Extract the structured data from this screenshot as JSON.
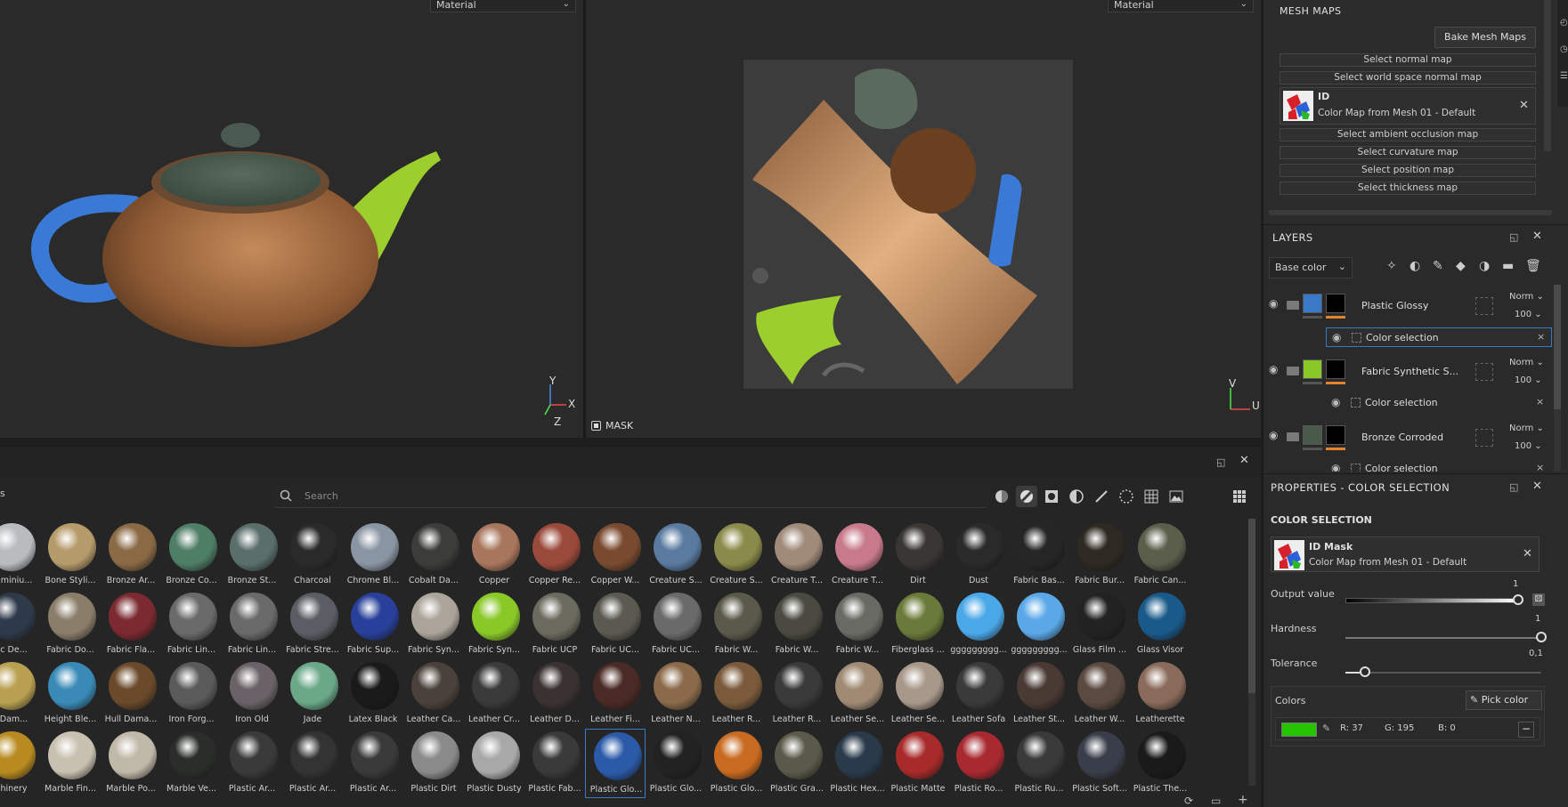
{
  "viewport3d": {
    "mode_label": "Material",
    "axes": [
      "Y",
      "X",
      "Z"
    ]
  },
  "viewport2d": {
    "mode_label": "Material",
    "mask_label": "MASK",
    "axes": [
      "V",
      "U"
    ]
  },
  "colors": {
    "accent_blue": "#3a78c8",
    "orange": "#e4822d",
    "id_green": "#25c300",
    "panel": "#2a2a2a",
    "background": "#1e1e1e"
  },
  "shelf": {
    "partial_title": "s",
    "search_placeholder": "Search",
    "filter_icons": [
      "materials-icon",
      "smart-materials-icon",
      "smart-masks-icon",
      "filters-icon",
      "brushes-icon",
      "particles-icon",
      "textures-icon",
      "environments-icon"
    ],
    "rows": [
      [
        {
          "label": "Aluminiu...",
          "color": "#b8bcbf"
        },
        {
          "label": "Bone Styli...",
          "color": "#b59a6a"
        },
        {
          "label": "Bronze Ar...",
          "color": "#8a6a45"
        },
        {
          "label": "Bronze Co...",
          "color": "#4e7e66"
        },
        {
          "label": "Bronze St...",
          "color": "#5a6e6a"
        },
        {
          "label": "Charcoal",
          "color": "#2a2a2a"
        },
        {
          "label": "Chrome Bl...",
          "color": "#8a95a3"
        },
        {
          "label": "Cobalt Da...",
          "color": "#3c3c3a"
        },
        {
          "label": "Copper",
          "color": "#a8765c"
        },
        {
          "label": "Copper Re...",
          "color": "#9a4a3a"
        },
        {
          "label": "Copper W...",
          "color": "#7a4a30"
        },
        {
          "label": "Creature S...",
          "color": "#5a7aa0"
        },
        {
          "label": "Creature S...",
          "color": "#8a8a4a"
        },
        {
          "label": "Creature T...",
          "color": "#a08a7a"
        },
        {
          "label": "Creature T...",
          "color": "#c87a8a"
        },
        {
          "label": "Dirt",
          "color": "#3a3634"
        },
        {
          "label": "Dust",
          "color": "#2a2a2a"
        },
        {
          "label": "Fabric Bas...",
          "color": "#262626"
        },
        {
          "label": "Fabric Bur...",
          "color": "#2e2a22"
        },
        {
          "label": "Fabric Can...",
          "color": "#5a5e4a"
        }
      ],
      [
        {
          "label": "...c De...",
          "color": "#2e3a4a"
        },
        {
          "label": "Fabric Do...",
          "color": "#8a7e6a"
        },
        {
          "label": "Fabric Fla...",
          "color": "#7a2a30"
        },
        {
          "label": "Fabric Lin...",
          "color": "#6a6a6a"
        },
        {
          "label": "Fabric Lin...",
          "color": "#6a6a6a"
        },
        {
          "label": "Fabric Stre...",
          "color": "#5a5e64"
        },
        {
          "label": "Fabric Sup...",
          "color": "#28409a"
        },
        {
          "label": "Fabric Syn...",
          "color": "#aaa49a"
        },
        {
          "label": "Fabric Syn...",
          "color": "#8ac828"
        },
        {
          "label": "Fabric UCP",
          "color": "#6a6a5e"
        },
        {
          "label": "Fabric UC...",
          "color": "#5a5a50"
        },
        {
          "label": "Fabric UC...",
          "color": "#6a6a6a"
        },
        {
          "label": "Fabric W...",
          "color": "#5a5a4a"
        },
        {
          "label": "Fabric W...",
          "color": "#4a4a40"
        },
        {
          "label": "Fabric W...",
          "color": "#6a6a64"
        },
        {
          "label": "Fiberglass ...",
          "color": "#6a7a3a"
        },
        {
          "label": "ggggggggg...",
          "color": "#4aa8e8"
        },
        {
          "label": "ggggggggg...",
          "color": "#5aa8e8"
        },
        {
          "label": "Glass Film ...",
          "color": "#222222"
        },
        {
          "label": "Glass Visor",
          "color": "#1a5a8a"
        }
      ],
      [
        {
          "label": "...Dam...",
          "color": "#b8a050"
        },
        {
          "label": "Height Ble...",
          "color": "#3a8ab8"
        },
        {
          "label": "Hull Dama...",
          "color": "#6a4a2a"
        },
        {
          "label": "Iron Forg...",
          "color": "#5a5a5a"
        },
        {
          "label": "Iron Old",
          "color": "#6a6266"
        },
        {
          "label": "Jade",
          "color": "#6aa888"
        },
        {
          "label": "Latex Black",
          "color": "#1a1a1a"
        },
        {
          "label": "Leather Ca...",
          "color": "#4a423a"
        },
        {
          "label": "Leather Cr...",
          "color": "#3a3a3a"
        },
        {
          "label": "Leather D...",
          "color": "#3a3230"
        },
        {
          "label": "Leather Fi...",
          "color": "#4a2a24"
        },
        {
          "label": "Leather N...",
          "color": "#8a6a4a"
        },
        {
          "label": "Leather R...",
          "color": "#7a5a3a"
        },
        {
          "label": "Leather R...",
          "color": "#3a3a3a"
        },
        {
          "label": "Leather Se...",
          "color": "#a08a74"
        },
        {
          "label": "Leather Se...",
          "color": "#a8988a"
        },
        {
          "label": "Leather Sofa",
          "color": "#3a3a3a"
        },
        {
          "label": "Leather St...",
          "color": "#4a3a34"
        },
        {
          "label": "Leather W...",
          "color": "#5a4a40"
        },
        {
          "label": "Leatherette",
          "color": "#8a6a5a"
        }
      ],
      [
        {
          "label": "...hinery",
          "color": "#b88a20"
        },
        {
          "label": "Marble Fin...",
          "color": "#c8c0b0"
        },
        {
          "label": "Marble Po...",
          "color": "#c0b8a8"
        },
        {
          "label": "Marble Ve...",
          "color": "#2a2e2a"
        },
        {
          "label": "Plastic Ar...",
          "color": "#3a3a3a"
        },
        {
          "label": "Plastic Ar...",
          "color": "#333333"
        },
        {
          "label": "Plastic Ar...",
          "color": "#3a3a3a"
        },
        {
          "label": "Plastic Dirt",
          "color": "#8a8a8a"
        },
        {
          "label": "Plastic Dusty",
          "color": "#a8a8a8"
        },
        {
          "label": "Plastic Fab...",
          "color": "#3a3a3a"
        },
        {
          "label": "Plastic Glo...",
          "color": "#2a5aa8"
        },
        {
          "label": "Plastic Glo...",
          "color": "#222222"
        },
        {
          "label": "Plastic Glo...",
          "color": "#c86a20"
        },
        {
          "label": "Plastic Gra...",
          "color": "#5a5a4a"
        },
        {
          "label": "Plastic Hex...",
          "color": "#2a3a4a"
        },
        {
          "label": "Plastic Matte",
          "color": "#a82a2a"
        },
        {
          "label": "Plastic Ro...",
          "color": "#a82a30"
        },
        {
          "label": "Plastic Ru...",
          "color": "#3a3a3a"
        },
        {
          "label": "Plastic Soft...",
          "color": "#3a3e4a"
        },
        {
          "label": "Plastic The...",
          "color": "#1a1a1a"
        }
      ]
    ],
    "selected_row": 3,
    "selected_col": 10
  },
  "mesh_maps": {
    "title": "MESH MAPS",
    "bake_label": "Bake Mesh Maps",
    "normal": "Select normal map",
    "world_normal": "Select world space normal map",
    "id_title": "ID",
    "id_value": "Color Map from Mesh 01 - Default",
    "ao": "Select ambient occlusion map",
    "curvature": "Select curvature map",
    "position": "Select position map",
    "thickness": "Select thickness map"
  },
  "layers": {
    "title": "LAYERS",
    "channel": "Base color",
    "items": [
      {
        "name": "Plastic Glossy",
        "blend": "Norm",
        "opacity": "100",
        "color": "#3a78c8",
        "sub": "Color selection"
      },
      {
        "name": "Fabric Synthetic S...",
        "blend": "Norm",
        "opacity": "100",
        "color": "#8ac828",
        "sub": "Color selection"
      },
      {
        "name": "Bronze Corroded",
        "blend": "Norm",
        "opacity": "100",
        "color": "#4a5a4a",
        "sub": "Color selection"
      }
    ]
  },
  "properties": {
    "title": "PROPERTIES - COLOR SELECTION",
    "section": "COLOR SELECTION",
    "id_title": "ID Mask",
    "id_value": "Color Map from Mesh 01 - Default",
    "output_label": "Output value",
    "output_val": "1",
    "output_fraction": 1.0,
    "hardness_label": "Hardness",
    "hardness_val": "1",
    "hardness_fraction": 1.0,
    "tolerance_label": "Tolerance",
    "tolerance_val": "0,1",
    "tolerance_fraction": 0.1,
    "colors_label": "Colors",
    "pick_label": "Pick color",
    "r": "R: 37",
    "g": "G: 195",
    "b": "B: 0"
  }
}
